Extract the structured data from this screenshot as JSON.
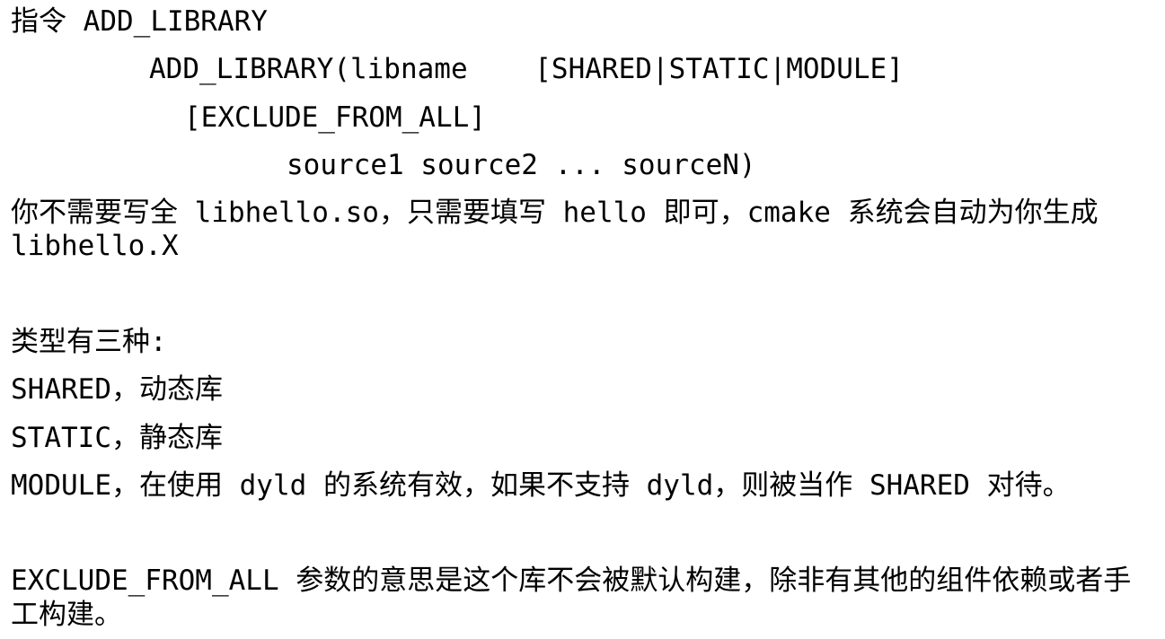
{
  "document": {
    "heading_line": "指令 ADD_LIBRARY",
    "syntax": {
      "line1": "ADD_LIBRARY(libname    [SHARED|STATIC|MODULE]",
      "line2": "[EXCLUDE_FROM_ALL]",
      "line3": "source1 source2 ... sourceN)"
    },
    "note_line1": "你不需要写全 libhello.so，只需要填写 hello 即可，cmake 系统会自动为你生成",
    "note_line2": "libhello.X",
    "types_heading": "类型有三种:",
    "types": [
      "SHARED，动态库",
      "STATIC，静态库",
      "MODULE，在使用 dyld 的系统有效，如果不支持 dyld，则被当作 SHARED 对待。"
    ],
    "exclude_line1": "EXCLUDE_FROM_ALL 参数的意思是这个库不会被默认构建，除非有其他的组件依赖或者手",
    "exclude_line2": "工构建。"
  }
}
